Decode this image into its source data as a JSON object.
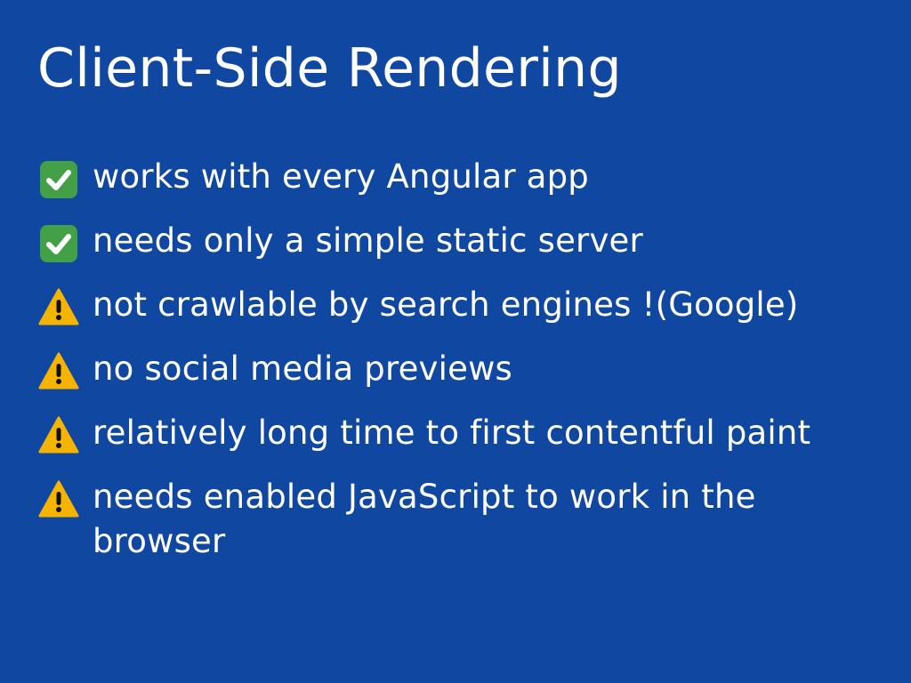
{
  "slide": {
    "title": "Client-Side Rendering",
    "bullets": [
      {
        "icon": "check-mark-icon",
        "text": "works with every Angular app"
      },
      {
        "icon": "check-mark-icon",
        "text": "needs only a simple static server"
      },
      {
        "icon": "warning-icon",
        "text": "not crawlable by search engines !(Google)"
      },
      {
        "icon": "warning-icon",
        "text": "no social media previews"
      },
      {
        "icon": "warning-icon",
        "text": "relatively long time to first contentful paint"
      },
      {
        "icon": "warning-icon",
        "text": "needs enabled JavaScript to work in the browser"
      }
    ]
  },
  "colors": {
    "background": "#0f47a1",
    "text": "#ffffff",
    "check_green": "#43a047",
    "warning_yellow": "#f4b400"
  }
}
